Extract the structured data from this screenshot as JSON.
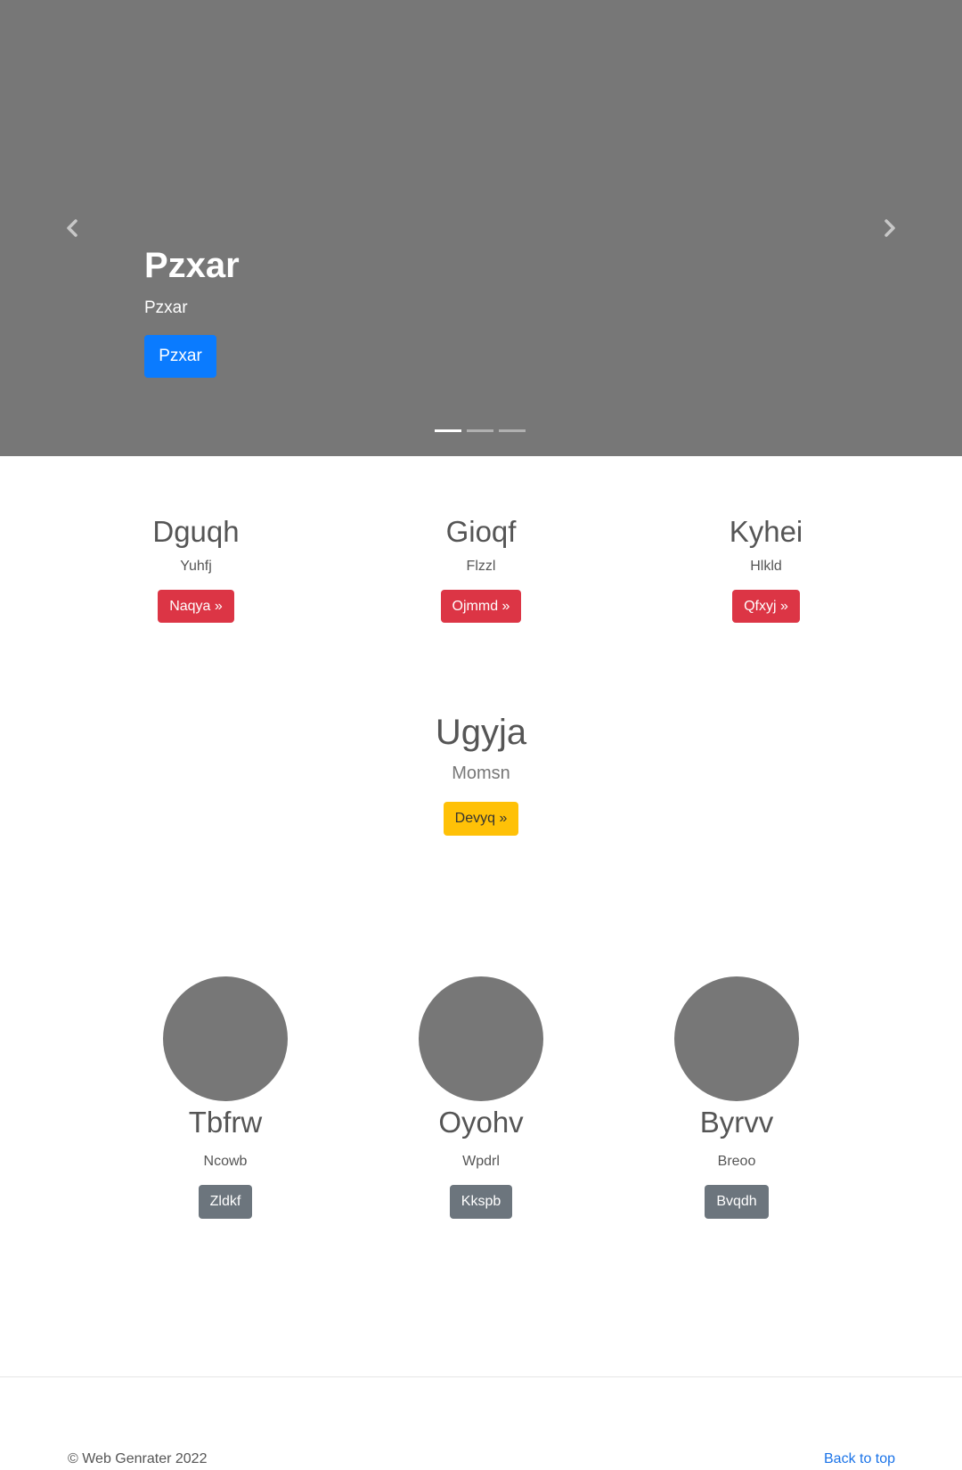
{
  "hero": {
    "title": "Pzxar",
    "subtitle": "Pzxar",
    "button_label": "Pzxar",
    "prev_icon": "chevron-left-icon",
    "next_icon": "chevron-right-icon",
    "slide_count": 3,
    "active_slide": 1,
    "background_color": "#777777",
    "button_color": "#0a7bff"
  },
  "features": [
    {
      "title": "Dguqh",
      "text": "Yuhfj",
      "button_label": "Naqya »"
    },
    {
      "title": "Gioqf",
      "text": "Flzzl",
      "button_label": "Ojmmd »"
    },
    {
      "title": "Kyhei",
      "text": "Hlkld",
      "button_label": "Qfxyj »"
    }
  ],
  "center": {
    "title": "Ugyja",
    "text": "Momsn",
    "button_label": "Devyq »"
  },
  "people": [
    {
      "name": "Tbfrw",
      "text": "Ncowb",
      "button_label": "Zldkf"
    },
    {
      "name": "Oyohv",
      "text": "Wpdrl",
      "button_label": "Kkspb"
    },
    {
      "name": "Byrvv",
      "text": "Breoo",
      "button_label": "Bvqdh"
    }
  ],
  "footer": {
    "copyright": "© Web Genrater 2022",
    "back_to_top": "Back to top"
  },
  "colors": {
    "danger": "#dc3545",
    "warning": "#ffc107",
    "secondary": "#6c757d",
    "link": "#1a73e8"
  }
}
